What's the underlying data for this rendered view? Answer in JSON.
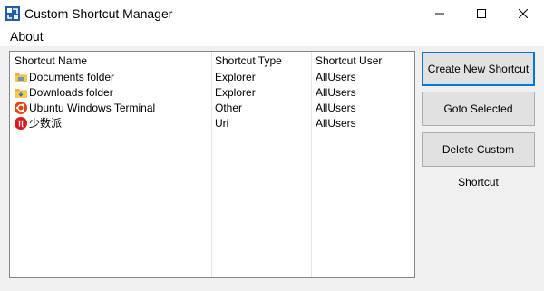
{
  "window": {
    "title": "Custom Shortcut Manager",
    "app_icon": "app-icon",
    "controls": [
      "minimize-icon",
      "maximize-icon",
      "close-icon"
    ]
  },
  "menu": {
    "items": [
      {
        "label": "About"
      }
    ]
  },
  "list": {
    "columns": [
      "Shortcut Name",
      "Shortcut Type",
      "Shortcut User"
    ],
    "rows": [
      {
        "name": "Documents folder",
        "type": "Explorer",
        "user": "AllUsers",
        "icon": "folder-icon"
      },
      {
        "name": "Downloads folder",
        "type": "Explorer",
        "user": "AllUsers",
        "icon": "downloads-folder-icon"
      },
      {
        "name": "Ubuntu Windows Terminal",
        "type": "Other",
        "user": "AllUsers",
        "icon": "ubuntu-icon"
      },
      {
        "name": "少数派",
        "type": "Uri",
        "user": "AllUsers",
        "icon": "sspai-icon"
      }
    ]
  },
  "buttons": {
    "create": "Create New Shortcut",
    "goto": "Goto Selected Shortcut",
    "delete": "Delete Custom Shortcut"
  },
  "colors": {
    "accent": "#0078d7",
    "folder": "#f8c94a",
    "ubuntu": "#dd4814",
    "sspai": "#d71a1b"
  }
}
